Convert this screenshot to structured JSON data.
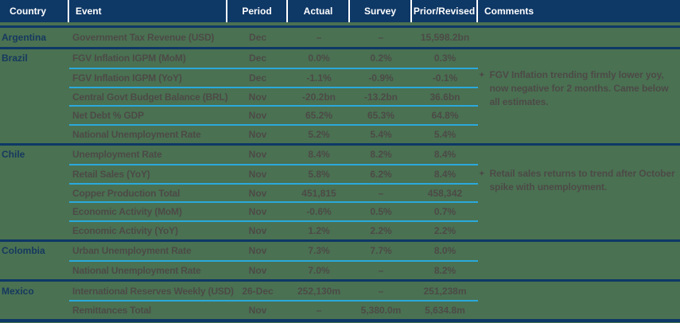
{
  "colors": {
    "background": "#4a7152",
    "header_bg": "#0e3866",
    "header_text": "#ffffff",
    "body_text": "#4d4a47",
    "country_text": "#16395f",
    "cyan_divider": "#2aa9dc",
    "navy_divider": "#0e3866"
  },
  "table": {
    "headers": [
      "Country",
      "Event",
      "Period",
      "Actual",
      "Survey",
      "Prior/Revised",
      "Comments"
    ],
    "rows": [
      {
        "country": "Argentina",
        "event": "Government Tax Revenue (USD)",
        "period": "Dec",
        "actual": "–",
        "survey": "–",
        "prior": "15,598.2bn"
      },
      {
        "country": "Brazil",
        "event": "FGV Inflation IGPM (MoM)",
        "period": "Dec",
        "actual": "0.0%",
        "survey": "0.2%",
        "prior": "0.3%"
      },
      {
        "country": "",
        "event": "FGV Inflation IGPM (YoY)",
        "period": "Dec",
        "actual": "-1.1%",
        "survey": "-0.9%",
        "prior": "-0.1%"
      },
      {
        "country": "",
        "event": "Central Govt Budget Balance (BRL)",
        "period": "Nov",
        "actual": "-20.2bn",
        "survey": "-13.2bn",
        "prior": "36.6bn"
      },
      {
        "country": "",
        "event": "Net Debt % GDP",
        "period": "Nov",
        "actual": "65.2%",
        "survey": "65.3%",
        "prior": "64.8%"
      },
      {
        "country": "",
        "event": "National Unemployment Rate",
        "period": "Nov",
        "actual": "5.2%",
        "survey": "5.4%",
        "prior": "5.4%"
      },
      {
        "country": "Chile",
        "event": "Unemployment Rate",
        "period": "Nov",
        "actual": "8.4%",
        "survey": "8.2%",
        "prior": "8.4%"
      },
      {
        "country": "",
        "event": "Retail Sales (YoY)",
        "period": "Nov",
        "actual": "5.8%",
        "survey": "6.2%",
        "prior": "8.4%"
      },
      {
        "country": "",
        "event": "Copper Production Total",
        "period": "Nov",
        "actual": "451,815",
        "survey": "–",
        "prior": "458,342"
      },
      {
        "country": "",
        "event": "Economic Activity (MoM)",
        "period": "Nov",
        "actual": "-0.6%",
        "survey": "0.5%",
        "prior": "0.7%"
      },
      {
        "country": "",
        "event": "Economic Activity (YoY)",
        "period": "Nov",
        "actual": "1.2%",
        "survey": "2.2%",
        "prior": "2.2%"
      },
      {
        "country": "Colombia",
        "event": "Urban Unemployment Rate",
        "period": "Nov",
        "actual": "7.3%",
        "survey": "7.7%",
        "prior": "8.0%"
      },
      {
        "country": "",
        "event": "National Unemployment Rate",
        "period": "Nov",
        "actual": "7.0%",
        "survey": "–",
        "prior": "8.2%"
      },
      {
        "country": "Mexico",
        "event": "International Reserves Weekly (USD)",
        "period": "26-Dec",
        "actual": "252,130m",
        "survey": "–",
        "prior": "251,238m"
      },
      {
        "country": "",
        "event": "Remittances Total",
        "period": "Nov",
        "actual": "–",
        "survey": "5,380.0m",
        "prior": "5,634.8m"
      }
    ],
    "comments": [
      {
        "bullet": "✦",
        "text": "FGV Inflation trending firmly lower yoy, now negative for 2 months. Came below all estimates."
      },
      {
        "bullet": "✦",
        "text": "Retail sales returns to trend after October spike with unemployment."
      }
    ]
  }
}
